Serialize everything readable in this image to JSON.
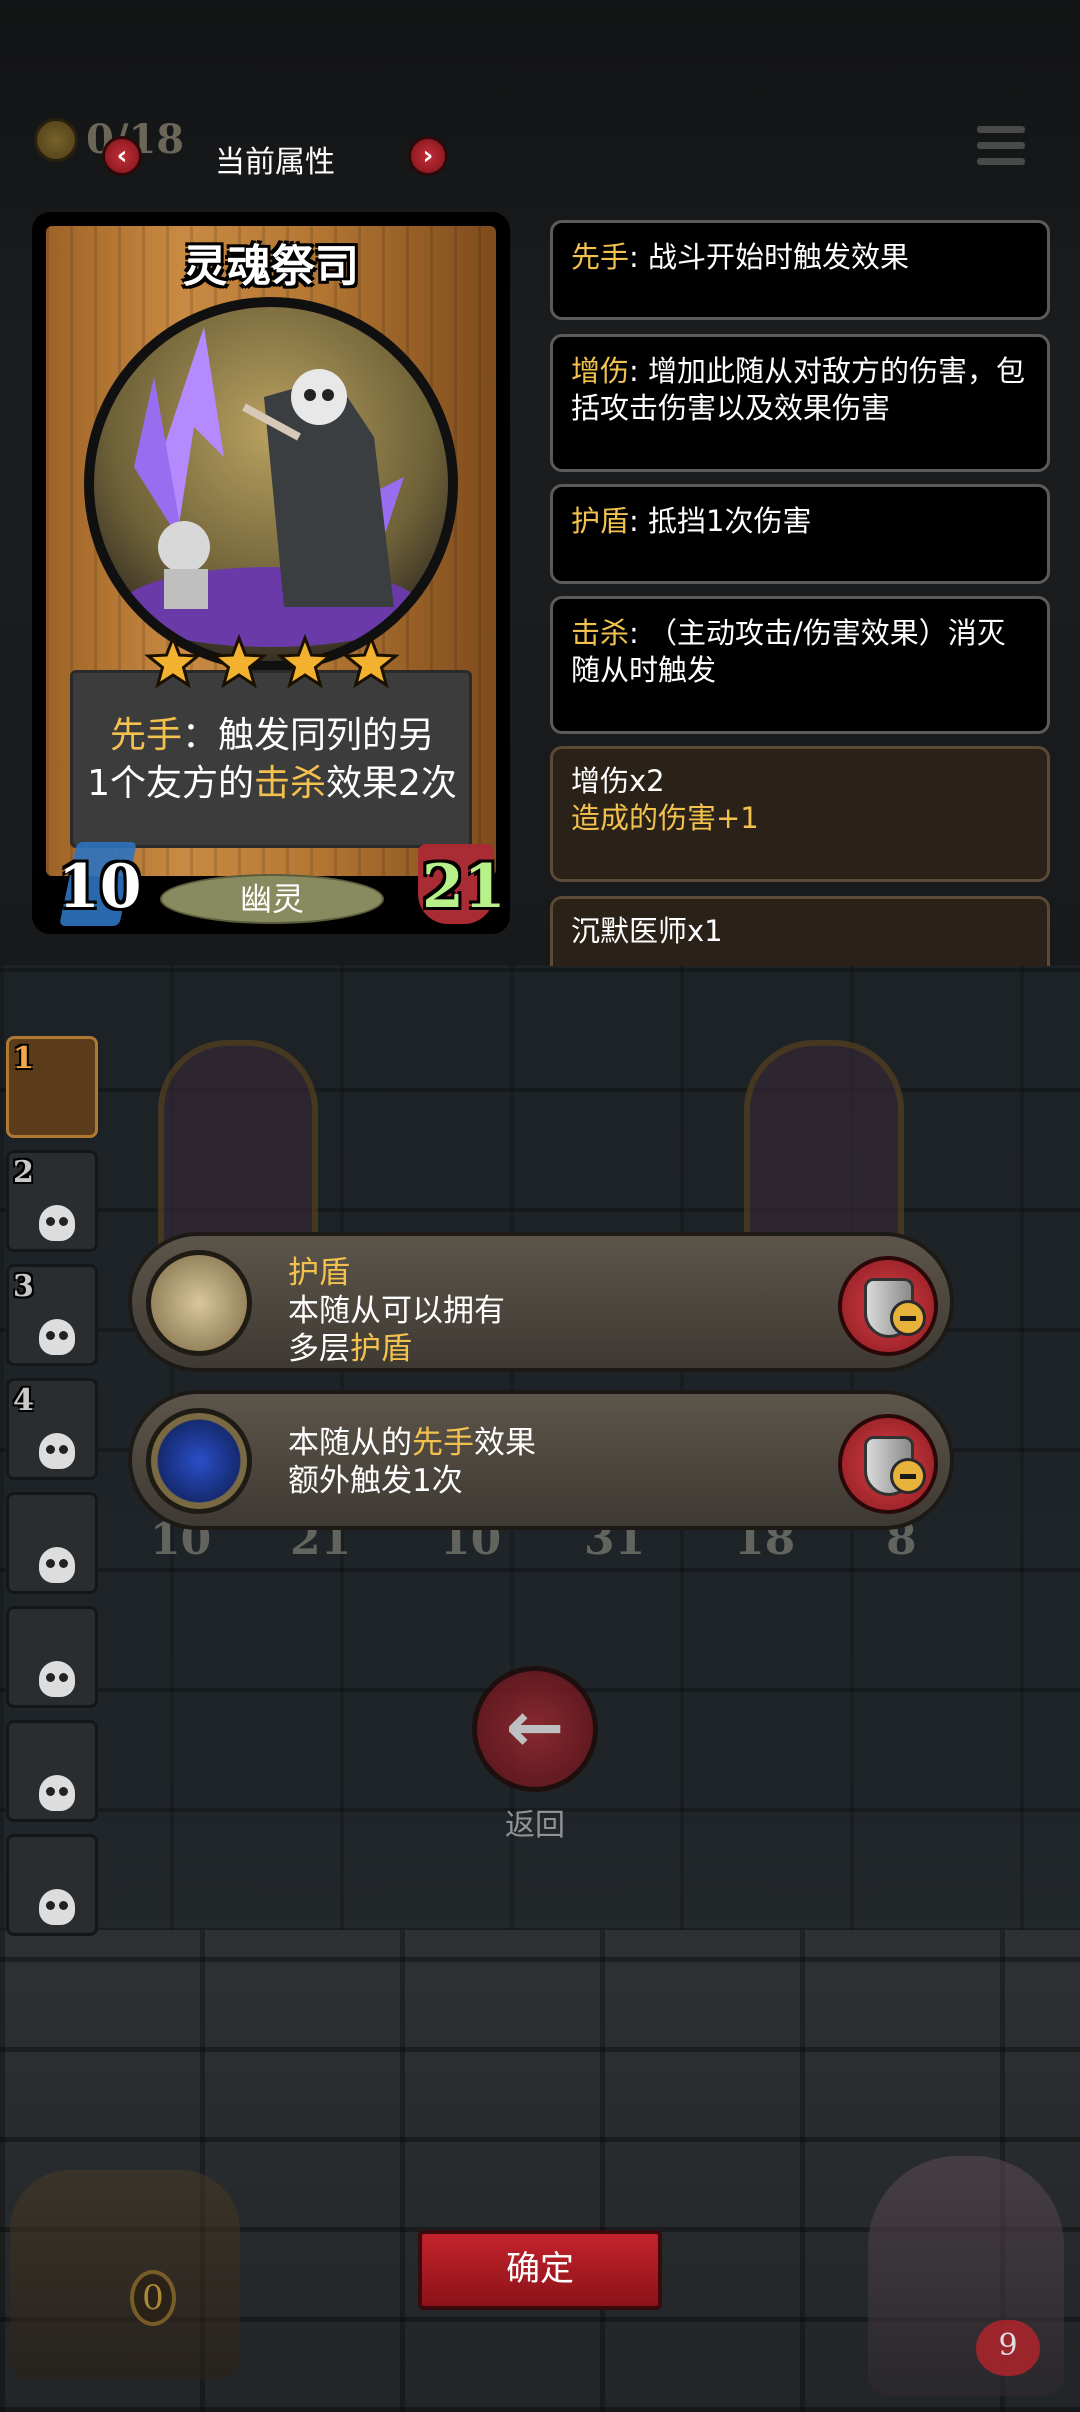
{
  "header": {
    "coin_count": "0/18",
    "title": "当前属性",
    "prev_label": "‹",
    "next_label": "›"
  },
  "card": {
    "name": "灵魂祭司",
    "stars": 4,
    "ability_line1_key": "先手",
    "ability_line1_rest": "：触发同列的另",
    "ability_line2_pre": "1个友方的",
    "ability_line2_key": "击杀",
    "ability_line2_post": "效果2次",
    "attack": "10",
    "health": "21",
    "type": "幽灵"
  },
  "keywords": [
    {
      "key": "先手",
      "text": ": 战斗开始时触发效果"
    },
    {
      "key": "增伤",
      "text": ": 增加此随从对敌方的伤害，包括攻击伤害以及效果伤害"
    },
    {
      "key": "护盾",
      "text": ": 抵挡1次伤害"
    },
    {
      "key": "击杀",
      "text": ": （主动攻击/伤害效果）消灭随从时触发"
    }
  ],
  "buffs": [
    {
      "title": "增伤x2",
      "sub": "造成的伤害+1"
    },
    {
      "title": "沉默医师x1",
      "sub": ""
    }
  ],
  "sidebar": {
    "slots": [
      "1",
      "2",
      "3",
      "4",
      "",
      "",
      "",
      ""
    ]
  },
  "board": {
    "stats": [
      "10",
      "21",
      "10",
      "31",
      "18",
      "8"
    ]
  },
  "enchants": [
    {
      "title": "护盾",
      "line1": "本随从可以拥有",
      "line2_pre": "多层",
      "line2_key": "护盾"
    },
    {
      "line1_pre": "本随从的",
      "line1_key": "先手",
      "line1_post": "效果",
      "line2": "额外触发1次"
    }
  ],
  "back": {
    "icon": "←",
    "label": "返回"
  },
  "confirm_label": "确定",
  "chest_count": "0",
  "hero_hp": "9",
  "colors": {
    "keyword": "#f2c14e",
    "button_red": "#c4232c",
    "health_green": "#b8f08a"
  },
  "icons": [
    "coin-icon",
    "menu-icon",
    "shield-remove-icon",
    "back-arrow-icon",
    "skull-icon"
  ]
}
